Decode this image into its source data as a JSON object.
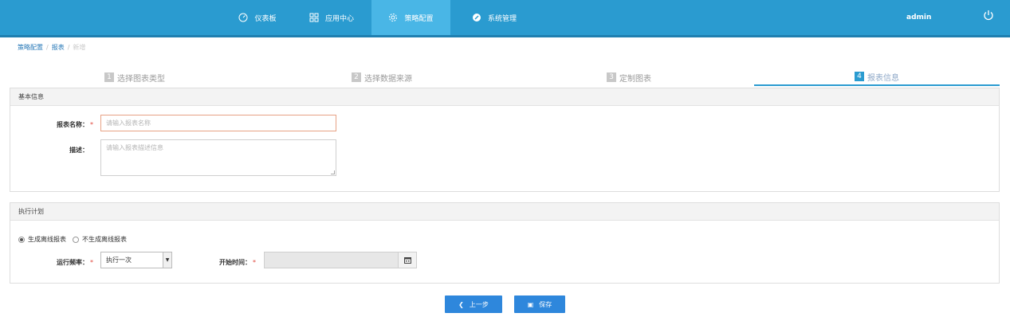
{
  "nav": {
    "items": [
      {
        "label": "仪表板",
        "icon": "gauge-icon"
      },
      {
        "label": "应用中心",
        "icon": "grid-icon"
      },
      {
        "label": "策略配置",
        "icon": "gear-icon",
        "active": true
      },
      {
        "label": "系统管理",
        "icon": "wrench-icon"
      }
    ],
    "user": "admin",
    "colors": {
      "bar": "#2a9bd0",
      "active": "#49b6e6"
    }
  },
  "breadcrumb": {
    "items": [
      "策略配置",
      "报表",
      "新增"
    ]
  },
  "steps": [
    {
      "num": "1",
      "label": "选择图表类型"
    },
    {
      "num": "2",
      "label": "选择数据来源"
    },
    {
      "num": "3",
      "label": "定制图表"
    },
    {
      "num": "4",
      "label": "报表信息",
      "active": true
    }
  ],
  "basic_info": {
    "title": "基本信息",
    "name_label": "报表名称：",
    "name_placeholder": "请输入报表名称",
    "desc_label": "描述：",
    "desc_placeholder": "请输入报表描述信息"
  },
  "schedule": {
    "title": "执行计划",
    "radio_on": "生成离线报表",
    "radio_off": "不生成离线报表",
    "freq_label": "运行频率：",
    "freq_value": "执行一次",
    "start_label": "开始时间："
  },
  "buttons": {
    "prev": "上一步",
    "save": "保存"
  }
}
